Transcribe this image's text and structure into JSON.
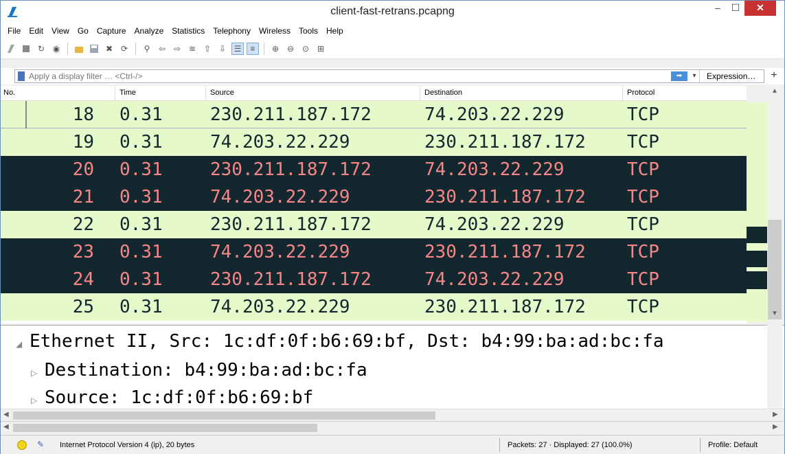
{
  "window": {
    "title": "client-fast-retrans.pcapng",
    "minimize": "–",
    "maximize": "☐",
    "close": "✕"
  },
  "menu": [
    "File",
    "Edit",
    "View",
    "Go",
    "Capture",
    "Analyze",
    "Statistics",
    "Telephony",
    "Wireless",
    "Tools",
    "Help"
  ],
  "toolbar": {
    "icons": [
      "start-capture-icon",
      "stop-capture-icon",
      "restart-capture-icon",
      "capture-options-icon",
      "open-file-icon",
      "save-file-icon",
      "close-file-icon",
      "reload-file-icon",
      "find-packet-icon",
      "go-back-icon",
      "go-forward-icon",
      "go-to-packet-icon",
      "go-first-icon",
      "go-last-icon",
      "autoscroll-icon",
      "colorize-icon",
      "zoom-in-icon",
      "zoom-out-icon",
      "zoom-normal-icon",
      "resize-columns-icon"
    ]
  },
  "filter": {
    "placeholder": "Apply a display filter … <Ctrl-/>",
    "expression_label": "Expression…",
    "plus_label": "+"
  },
  "packet_list": {
    "columns": [
      "No.",
      "Time",
      "Source",
      "Destination",
      "Protocol"
    ],
    "rows": [
      {
        "no": "18",
        "time": "0.31",
        "source": "230.211.187.172",
        "destination": "74.203.22.229",
        "protocol": "TCP",
        "style": "light"
      },
      {
        "no": "19",
        "time": "0.31",
        "source": "74.203.22.229",
        "destination": "230.211.187.172",
        "protocol": "TCP",
        "style": "light"
      },
      {
        "no": "20",
        "time": "0.31",
        "source": "230.211.187.172",
        "destination": "74.203.22.229",
        "protocol": "TCP",
        "style": "dark"
      },
      {
        "no": "21",
        "time": "0.31",
        "source": "74.203.22.229",
        "destination": "230.211.187.172",
        "protocol": "TCP",
        "style": "dark"
      },
      {
        "no": "22",
        "time": "0.31",
        "source": "230.211.187.172",
        "destination": "74.203.22.229",
        "protocol": "TCP",
        "style": "light"
      },
      {
        "no": "23",
        "time": "0.31",
        "source": "74.203.22.229",
        "destination": "230.211.187.172",
        "protocol": "TCP",
        "style": "dark"
      },
      {
        "no": "24",
        "time": "0.31",
        "source": "230.211.187.172",
        "destination": "74.203.22.229",
        "protocol": "TCP",
        "style": "dark"
      },
      {
        "no": "25",
        "time": "0.31",
        "source": "74.203.22.229",
        "destination": "230.211.187.172",
        "protocol": "TCP",
        "style": "light"
      }
    ]
  },
  "details": {
    "ethernet": "Ethernet II, Src: 1c:df:0f:b6:69:bf, Dst: b4:99:ba:ad:bc:fa",
    "destination": "Destination: b4:99:ba:ad:bc:fa",
    "source": "Source: 1c:df:0f:b6:69:bf"
  },
  "status": {
    "field_info": "Internet Protocol Version 4 (ip), 20 bytes",
    "packets": "Packets: 27 · Displayed: 27 (100.0%)",
    "profile": "Profile: Default"
  },
  "colors": {
    "row_light_bg": "#e5f9ca",
    "row_dark_bg": "#12272e",
    "row_dark_fg": "#f78787",
    "close_button": "#c7312f"
  }
}
